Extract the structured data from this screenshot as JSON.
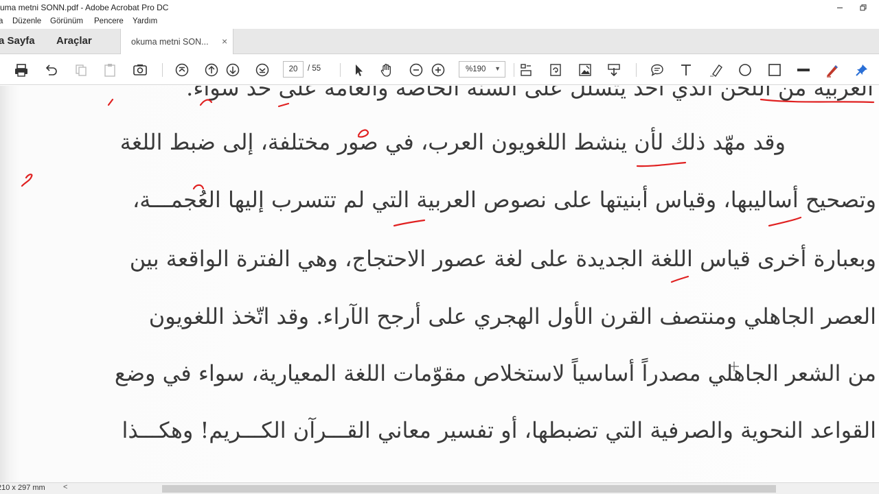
{
  "window": {
    "title": "kuma metni SONN.pdf - Adobe Acrobat Pro DC",
    "minimize_icon": "minimize-icon",
    "restore_icon": "restore-icon"
  },
  "menu": {
    "items": [
      "a",
      "Düzenle",
      "Görünüm",
      "Pencere",
      "Yardım"
    ]
  },
  "tabs": {
    "home": "a Sayfa",
    "tools": "Araçlar",
    "document": "okuma metni SON...",
    "close_glyph": "×"
  },
  "toolbar": {
    "icons": [
      "print-icon",
      "undo-icon",
      "copy-icon",
      "paste-icon",
      "screenshot-icon",
      "first-page-icon",
      "prev-page-icon",
      "next-page-icon",
      "last-page-icon",
      "select-arrow-icon",
      "hand-icon",
      "zoom-out-icon",
      "zoom-in-icon",
      "crop-icon",
      "rotate-icon",
      "image-icon",
      "download-icon",
      "comment-icon",
      "text-icon",
      "highlight-icon",
      "circle-icon",
      "rectangle-icon",
      "strikethrough-icon",
      "pen-icon",
      "pin-icon"
    ],
    "current_page": "20",
    "total_pages": "/ 55",
    "zoom": "%190",
    "zoom_arrow": "▼"
  },
  "document": {
    "lines": [
      "العربية من اللحن الذي أخذ يتسلل على ألسنة الخاصة والعامة على حدّ سواء.",
      "وقد مهّد ذلك لأن ينشط اللغويون العرب، في صور مختلفة، إلى ضبط اللغة",
      "وتصحيح أساليبها، وقياس أبنيتها على نصوص العربية التي لم تتسرب إليها العُجمـــة،",
      "وبعبارة أخرى قياس اللغة الجديدة على لغة عصور الاحتجاج، وهي الفترة الواقعة بين",
      "العصر الجاهلي ومنتصف القرن الأول الهجري على أرجح الآراء. وقد اتّخذ اللغويون",
      "من الشعر الجاهلي مصدراً أساسياً لاستخلاص مقوّمات اللغة المعيارية، سواء في وضع",
      "القواعد النحوية والصرفية التي تضبطها، أو تفسير معاني القـــرآن الكـــريم! وهكـــذا"
    ]
  },
  "colors": {
    "annotation": "#e02020",
    "pen_icon": "#c0392b",
    "pin_icon": "#2a6fd6",
    "text": "#3a3a3a"
  },
  "status": {
    "page_size": "210 x 297 mm",
    "scroll_left": "<"
  }
}
